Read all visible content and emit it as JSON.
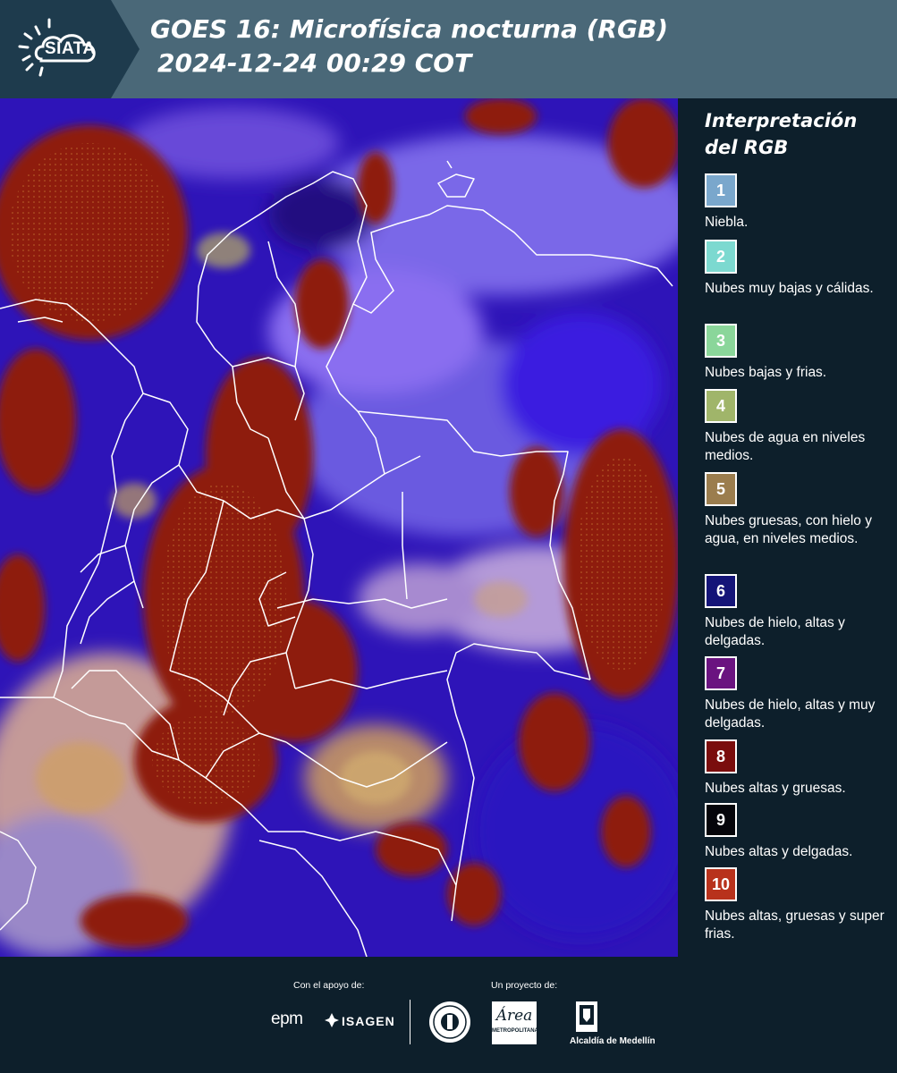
{
  "header": {
    "logo_text": "SIATA",
    "title_line1": "GOES 16: Microfísica nocturna (RGB)",
    "title_line2": "2024-12-24 00:29 COT"
  },
  "legend": {
    "title_line1": "Interpretación",
    "title_line2": "del RGB",
    "items": [
      {
        "num": "1",
        "label": "Niebla.",
        "color": "#7aa7cc"
      },
      {
        "num": "2",
        "label": "Nubes muy bajas y cálidas.",
        "color": "#7cd9d0"
      },
      {
        "num": "3",
        "label": "Nubes bajas y frias.",
        "color": "#8ad69a"
      },
      {
        "num": "4",
        "label": "Nubes de agua en niveles medios.",
        "color": "#a0b56a"
      },
      {
        "num": "5",
        "label": "Nubes gruesas, con hielo y agua, en niveles medios.",
        "color": "#9b7d4e"
      },
      {
        "num": "6",
        "label": "Nubes de hielo, altas y delgadas.",
        "color": "#141478"
      },
      {
        "num": "7",
        "label": "Nubes de hielo, altas y muy delgadas.",
        "color": "#6a1380"
      },
      {
        "num": "8",
        "label": "Nubes altas y gruesas.",
        "color": "#7a0d0d"
      },
      {
        "num": "9",
        "label": "Nubes altas y delgadas.",
        "color": "#05050a"
      },
      {
        "num": "10",
        "label": "Nubes altas, gruesas y super frias.",
        "color": "#b8321c"
      }
    ]
  },
  "footer": {
    "support_label": "Con el apoyo de:",
    "project_label": "Un proyecto de:",
    "epm": "epm",
    "isagen": "ISAGEN",
    "area_text": "Área",
    "area_sub": "METROPOLITANA",
    "alcaldia": "Alcaldía de Medellín"
  },
  "colors": {
    "header_bg": "#4a6878",
    "panel_bg": "#0d1f2b",
    "cloud_blue": "#3a1ee0",
    "cloud_red": "#8e1a0c",
    "cloud_violet": "#8a6ef0",
    "border_white": "#ffffff"
  }
}
